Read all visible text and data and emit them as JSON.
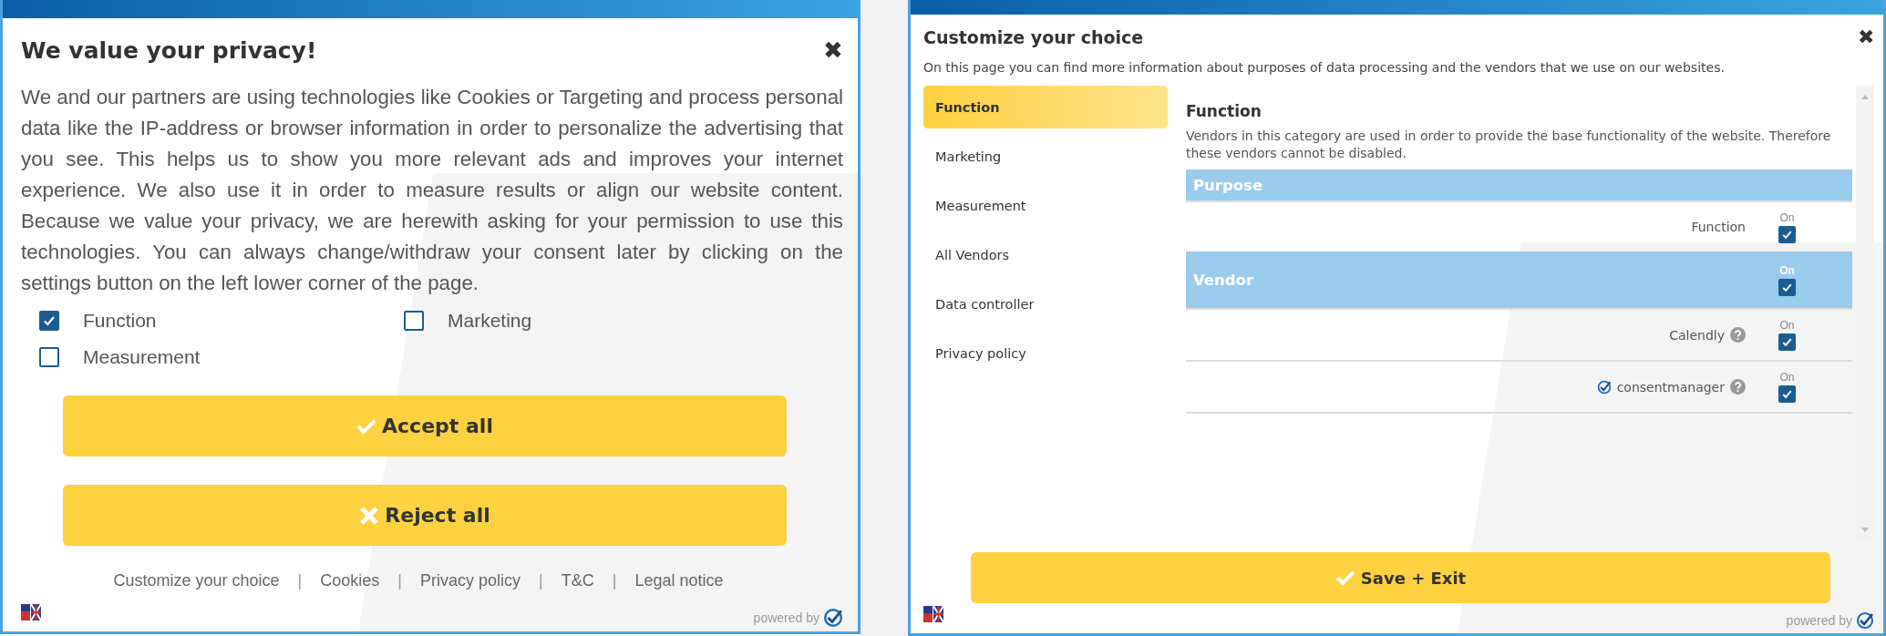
{
  "privacy_dialog": {
    "title": "We value your privacy!",
    "close": "✖",
    "text": "We and our partners are using technologies like Cookies or Targeting and process personal data like the IP-address or browser information in order to personalize the advertising that you see. This helps us to show you more relevant ads and improves your internet experience. We also use it in order to measure results or align our website content. Because we value your privacy, we are herewith asking for your permission to use this technologies. You can always change/withdraw your consent later by clicking on the settings button on the left lower corner of the page.",
    "options": [
      {
        "label": "Function",
        "checked": true
      },
      {
        "label": "Marketing",
        "checked": false
      },
      {
        "label": "Measurement",
        "checked": false
      }
    ],
    "buttons": [
      {
        "label": "Accept all",
        "kind": "accept"
      },
      {
        "label": "Reject all",
        "kind": "reject"
      }
    ],
    "links": [
      "Customize your choice",
      "Cookies",
      "Privacy policy",
      "T&C",
      "Legal notice"
    ],
    "link_separator": "|",
    "powered_by": "powered by"
  },
  "customize_dialog": {
    "title": "Customize your choice",
    "close": "✖",
    "subtitle": "On this page you can find more information about purposes of data processing and the vendors that we use on our websites.",
    "nav": [
      {
        "label": "Function",
        "selected": true
      },
      {
        "label": "Marketing",
        "selected": false
      },
      {
        "label": "Measurement",
        "selected": false
      },
      {
        "label": "All Vendors",
        "selected": false
      },
      {
        "label": "Data controller",
        "selected": false
      },
      {
        "label": "Privacy policy",
        "selected": false
      }
    ],
    "section_title": "Function",
    "section_text": "Vendors in this category are used in order to provide the base functionality of the website. Therefore these vendors cannot be disabled.",
    "purpose_header": "Purpose",
    "purposes": [
      {
        "name": "Function",
        "toggle_label": "On",
        "checked": true
      }
    ],
    "vendor_header": {
      "label": "Vendor",
      "toggle_label": "On",
      "checked": true
    },
    "vendors": [
      {
        "name": "Calendly",
        "toggle_label": "On",
        "checked": true,
        "logo": false
      },
      {
        "name": "consentmanager",
        "toggle_label": "On",
        "checked": true,
        "logo": true
      }
    ],
    "save_button": "Save + Exit",
    "powered_by": "powered by"
  }
}
